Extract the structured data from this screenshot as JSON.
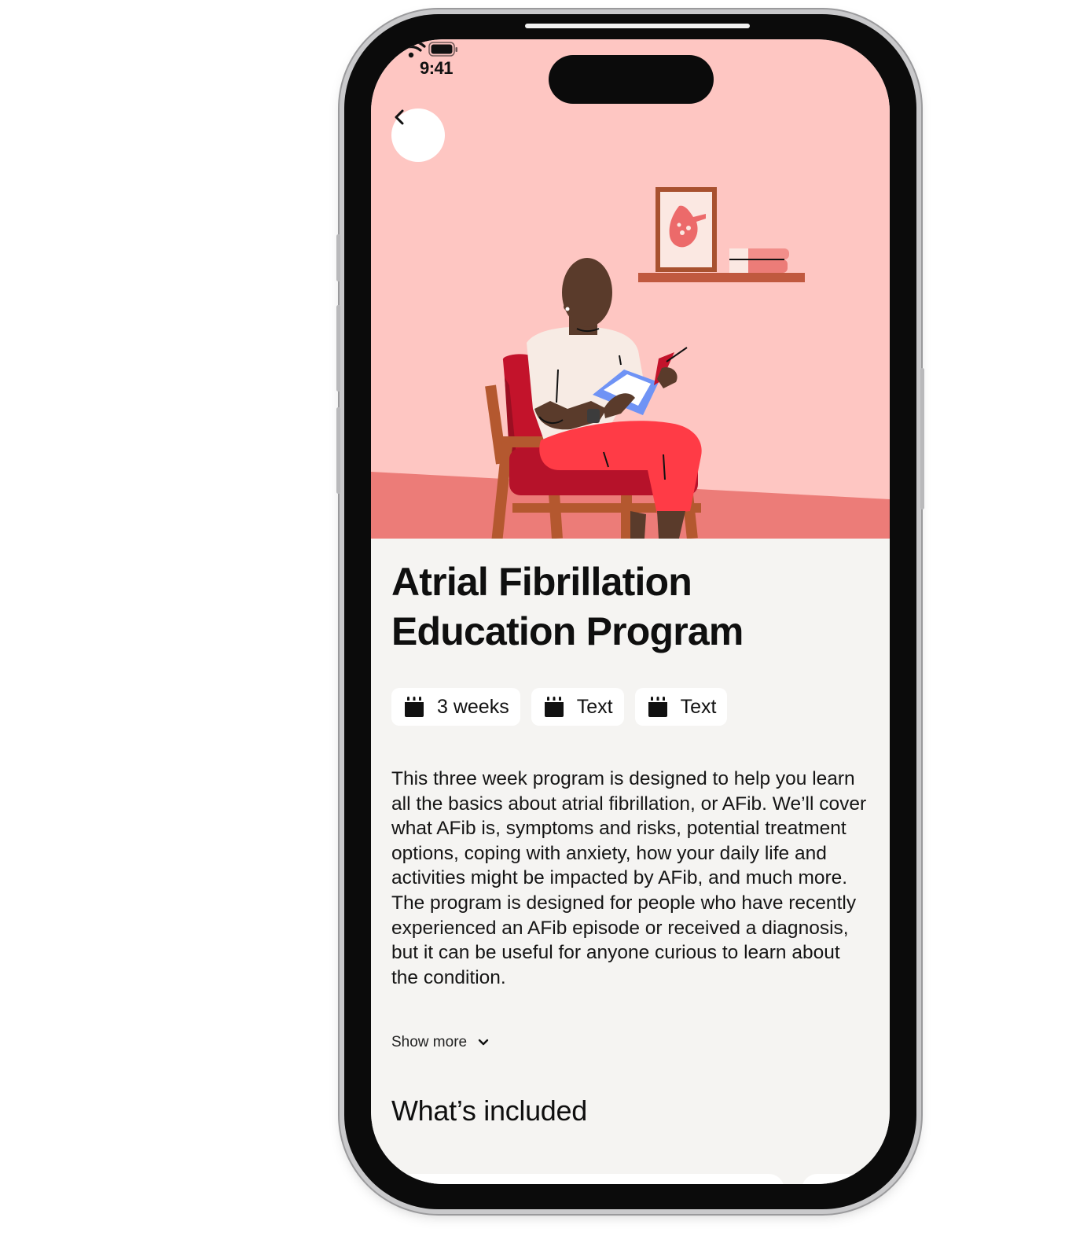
{
  "status_bar": {
    "time": "9:41"
  },
  "program": {
    "title": "Atrial Fibrillation Education Program",
    "tags": [
      {
        "icon": "calendar-icon",
        "label": "3 weeks"
      },
      {
        "icon": "calendar-icon",
        "label": "Text"
      },
      {
        "icon": "calendar-icon",
        "label": "Text"
      }
    ],
    "description": "This three week program is designed to help you learn all the basics about atrial fibrillation, or AFib. We’ll cover what AFib is, symptoms and risks, potential treatment options, coping with anxiety, how your daily life and activities might be impacted by AFib, and much more. The program is designed for people who have recently experienced an AFib episode or received a diagnosis, but it can be useful for anyone curious to learn about the condition.",
    "show_more_label": "Show more"
  },
  "section": {
    "title": "What’s included"
  },
  "colors": {
    "hero_background": "#fec6c2",
    "floor": "#ec7c78",
    "content_background": "#f5f4f2",
    "chip_background": "#ffffff"
  }
}
